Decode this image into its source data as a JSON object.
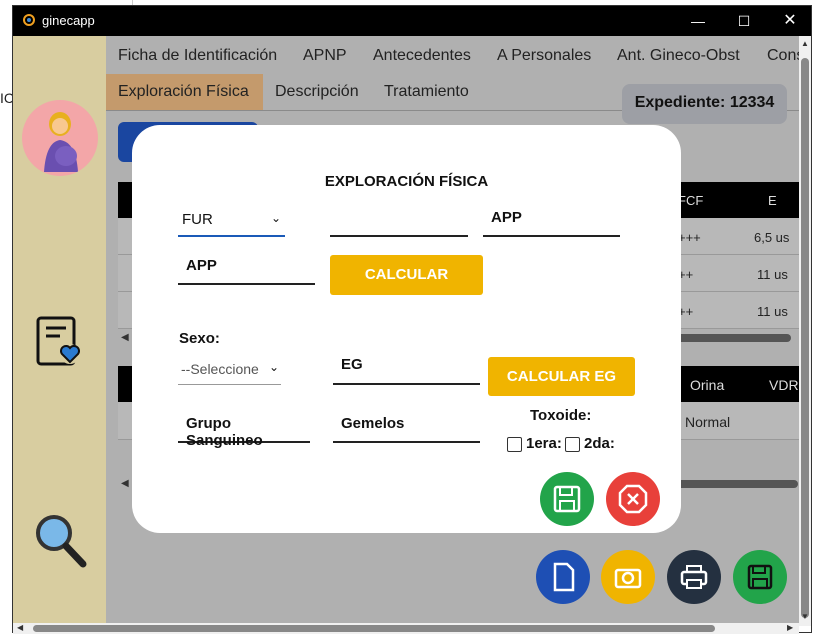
{
  "window": {
    "title": "ginecapp"
  },
  "background_text": {
    "left_fragment": "IC"
  },
  "tabs": [
    "Ficha de Identificación",
    "APNP",
    "Antecedentes",
    "A Personales",
    "Ant. Gineco-Obst",
    "Cons"
  ],
  "tabs_row2": [
    "Exploración Física",
    "Descripción",
    "Tratamiento"
  ],
  "expediente": "Expediente: 12334",
  "table1": {
    "headers": [
      "FCF",
      "E"
    ],
    "rows": [
      [
        "+++",
        "6,5 us"
      ],
      [
        "++",
        "11 us"
      ],
      [
        "++",
        "11 us"
      ]
    ]
  },
  "table2": {
    "headers": [
      "Orina",
      "VDR"
    ],
    "rows": [
      [
        "Normal",
        ""
      ]
    ]
  },
  "modal": {
    "title": "EXPLORACIÓN FÍSICA",
    "fur_label": "FUR",
    "app_field1": "APP",
    "app_field2": "APP",
    "calcular": "CALCULAR",
    "sexo_label": "Sexo:",
    "sexo_select": "--Seleccione",
    "eg_field": "EG",
    "calcular_eg": "CALCULAR EG",
    "grupo": "Grupo Sanguineo",
    "gemelos": "Gemelos",
    "toxoide_label": "Toxoide:",
    "check1": "1era:",
    "check2": "2da:"
  },
  "colors": {
    "accent_yellow": "#f0b400",
    "save_green": "#22a44a",
    "cancel_red": "#e8403a",
    "sidebar": "#d8cda0",
    "doc_blue": "#1e4fb4"
  }
}
